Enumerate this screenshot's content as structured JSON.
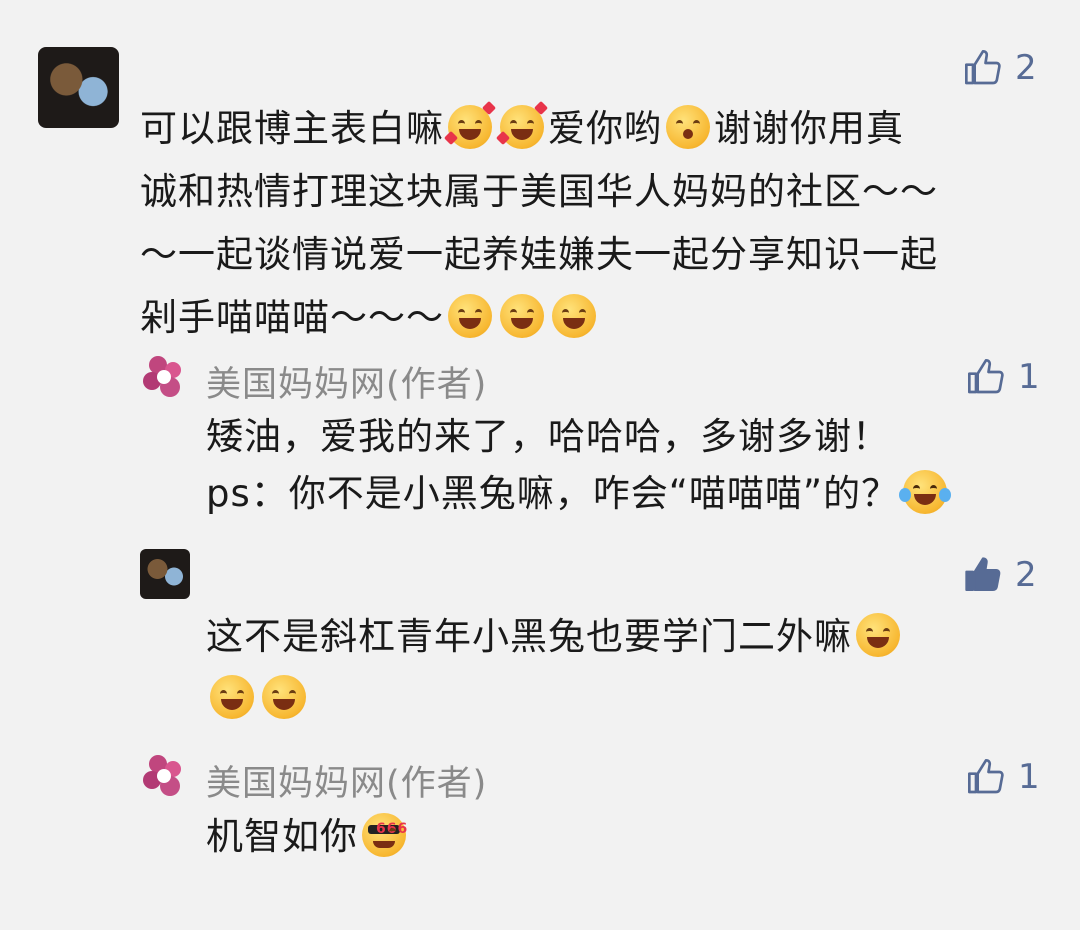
{
  "comments": [
    {
      "likes": "2",
      "text_parts": [
        "可以跟博主表白嘛",
        "爱你哟",
        "谢谢你用真诚和热情打理这块属于美国华人妈妈的社区～～～一起谈情说爱一起养娃嫌夫一起分享知识一起剁手喵喵喵～～～"
      ],
      "line1": "可以跟博主表白嘛",
      "line1b": "爱你哟",
      "line1c": "谢谢你用真",
      "line2": "诚和热情打理这块属于美国华人妈妈的社区～～",
      "line3": "～一起谈情说爱一起养娃嫌夫一起分享知识一起",
      "line4": "剁手喵喵喵～～～"
    },
    {
      "author": "美国妈妈网(作者)",
      "likes": "1",
      "line1": "矮油，爱我的来了，哈哈哈，多谢多谢！",
      "line2": "ps：你不是小黑兔嘛，咋会“喵喵喵”的？"
    },
    {
      "likes": "2",
      "line1": "这不是斜杠青年小黑兔也要学门二外嘛"
    },
    {
      "author": "美国妈妈网(作者)",
      "likes": "1",
      "line1": "机智如你"
    }
  ],
  "emoji_text": "666",
  "colors": {
    "link_blue": "#576b95",
    "author_gray": "#8a8a8a",
    "background": "#f2f2f2"
  },
  "icons": [
    "thumbs-up-outline-icon",
    "thumbs-up-filled-icon",
    "heart-pink-logo"
  ]
}
